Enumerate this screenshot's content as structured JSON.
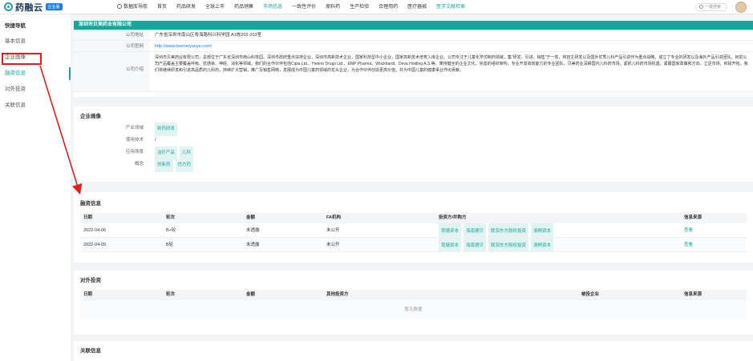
{
  "header": {
    "logo_text": "药融云",
    "logo_badge": "企业版",
    "nav": [
      {
        "label": "数据库导航"
      },
      {
        "label": "首页"
      },
      {
        "label": "药品研发"
      },
      {
        "label": "全球上市"
      },
      {
        "label": "药品销售"
      },
      {
        "label": "市场信息"
      },
      {
        "label": "一致性评价"
      },
      {
        "label": "原料药"
      },
      {
        "label": "生产检验"
      },
      {
        "label": "合理用药"
      },
      {
        "label": "医疗器械"
      },
      {
        "label": "医学文献检索"
      }
    ],
    "search_placeholder": "一键搜索"
  },
  "sidebar": {
    "title": "快捷导航",
    "items": [
      {
        "label": "基本信息"
      },
      {
        "label": "企业画像"
      },
      {
        "label": "融资信息"
      },
      {
        "label": "对外投资"
      },
      {
        "label": "关联信息"
      }
    ]
  },
  "company": {
    "name": "深圳市贝美药业有限公司",
    "address_label": "公司地址",
    "address": "广东省深圳市南山区粤海路科兴科学园 A1栋202-203室",
    "website_label": "公司官网",
    "website": "http://www.beimeiyaoye.com/",
    "intro_label": "公司介绍",
    "intro": "深圳市贝美药业有限公司，总部位于广东省深圳市南山科技园。深圳市政府重点扶持企业，深圳市高新技术企业，国家科技型中小企业，国家高新技术培育入库企业。公司专注于儿童化学仿制药领域，集“研发、引进、销售”于一体，将自主研发以及国外优秀儿科产品引进作为重点战略，成立了专业的研发以及海外产品引进团队。目前公司产品覆盖主要覆盖呼吸、抗感染、神经、消化等领域。我们的合作伙伴包括Cipla Ltd.、Hetero Drugs Ltd.、EMP Pharma、Wockhardt、Deva Holding A.S.等。秉持健全的企业文化，完善的组织架构，专业开发高效能力的专业团队，贝美药业深耕国内儿科药市场，紧抓儿科药市场机遇，紧跟国家政策和方向，立足市场，积极开拓。我们将继续研发和引进高品质的儿科药，持续扩大营销，推广及销售网络，发展成为中国儿童药领域的龙头企业，为合作伙伴创造更高价值，并为中国儿童的健康事业作出贡献。"
  },
  "portrait": {
    "title": "企业画像",
    "rows": [
      {
        "label": "产业领域",
        "tags": [
          "新药研发"
        ]
      },
      {
        "label": "使用技术",
        "text": "/"
      },
      {
        "label": "应用场景",
        "tags": [
          "治疗产品",
          "儿科"
        ]
      },
      {
        "label": "概念",
        "tags": [
          "创新药",
          "仿方药"
        ]
      }
    ]
  },
  "financing": {
    "title": "融资信息",
    "headers": [
      "日期",
      "轮次",
      "金额",
      "FA机构",
      "投资方/并购方",
      "信息来源"
    ],
    "rows": [
      {
        "date": "2022-04-06",
        "round": "B+轮",
        "amount": "未透露",
        "fa": "未公开",
        "investors": [
          "荷塘资本",
          "海南德贝",
          "联润东方股权投资",
          "清桐资本"
        ],
        "source": "查看"
      },
      {
        "date": "2022-04-05",
        "round": "B轮",
        "amount": "未透露",
        "fa": "未公开",
        "investors": [
          "荷塘资本",
          "海南德贝",
          "联润东方股权投资",
          "清桐资本"
        ],
        "source": "查看"
      }
    ]
  },
  "investment": {
    "title": "对外投资",
    "headers": [
      "日期",
      "轮次",
      "金额",
      "其他投资方",
      "被投企业",
      "信息来源"
    ],
    "empty": "暂无数据"
  },
  "related": {
    "title": "关联信息"
  },
  "colors": {
    "accent": "#1ba39c",
    "annotation": "#e02020",
    "link": "#1e7de6"
  }
}
